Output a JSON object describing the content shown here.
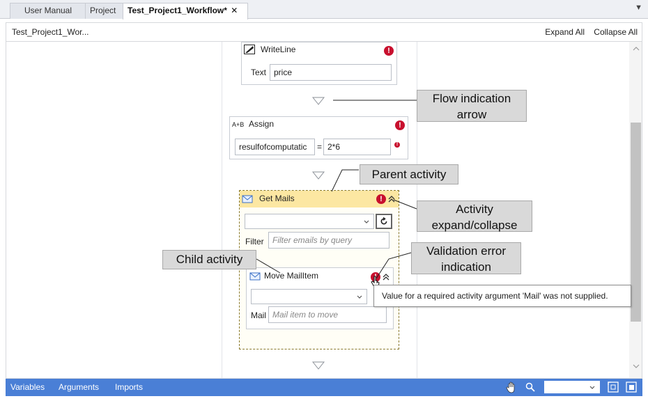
{
  "tabs": [
    {
      "label": "User Manual"
    },
    {
      "label": "Project"
    },
    {
      "label": "Test_Project1_Workflow*",
      "close": "✕"
    }
  ],
  "tab_overflow_glyph": "▼",
  "breadcrumb": "Test_Project1_Wor...",
  "toolbar": {
    "expand_all": "Expand All",
    "collapse_all": "Collapse All"
  },
  "writeline": {
    "title": "WriteLine",
    "text_label": "Text",
    "text_value": "price"
  },
  "assign": {
    "icon_text": "A+B",
    "title": "Assign",
    "left_value": "resulfofcomputatic",
    "equals": "=",
    "right_value": "2*6"
  },
  "get_mails": {
    "title": "Get Mails",
    "filter_label": "Filter",
    "filter_placeholder": "Filter emails by query"
  },
  "move_mail": {
    "title": "Move MailItem",
    "mail_label": "Mail",
    "mail_placeholder": "Mail item to move"
  },
  "error_glyph": "!",
  "callouts": {
    "flow_arrow": "Flow indication arrow",
    "parent_activity": "Parent activity",
    "expand_collapse": "Activity expand/collapse",
    "child_activity": "Child activity",
    "validation_error": "Validation error indication"
  },
  "tooltip": "Value for a required activity argument 'Mail' was not supplied.",
  "bottom_bar": {
    "variables": "Variables",
    "arguments": "Arguments",
    "imports": "Imports",
    "zoom_value": ""
  },
  "colors": {
    "accent_blue": "#4a7fd6",
    "error_red": "#c8102e",
    "parent_header": "#fce7a2",
    "callout_bg": "#d9d9d9"
  }
}
